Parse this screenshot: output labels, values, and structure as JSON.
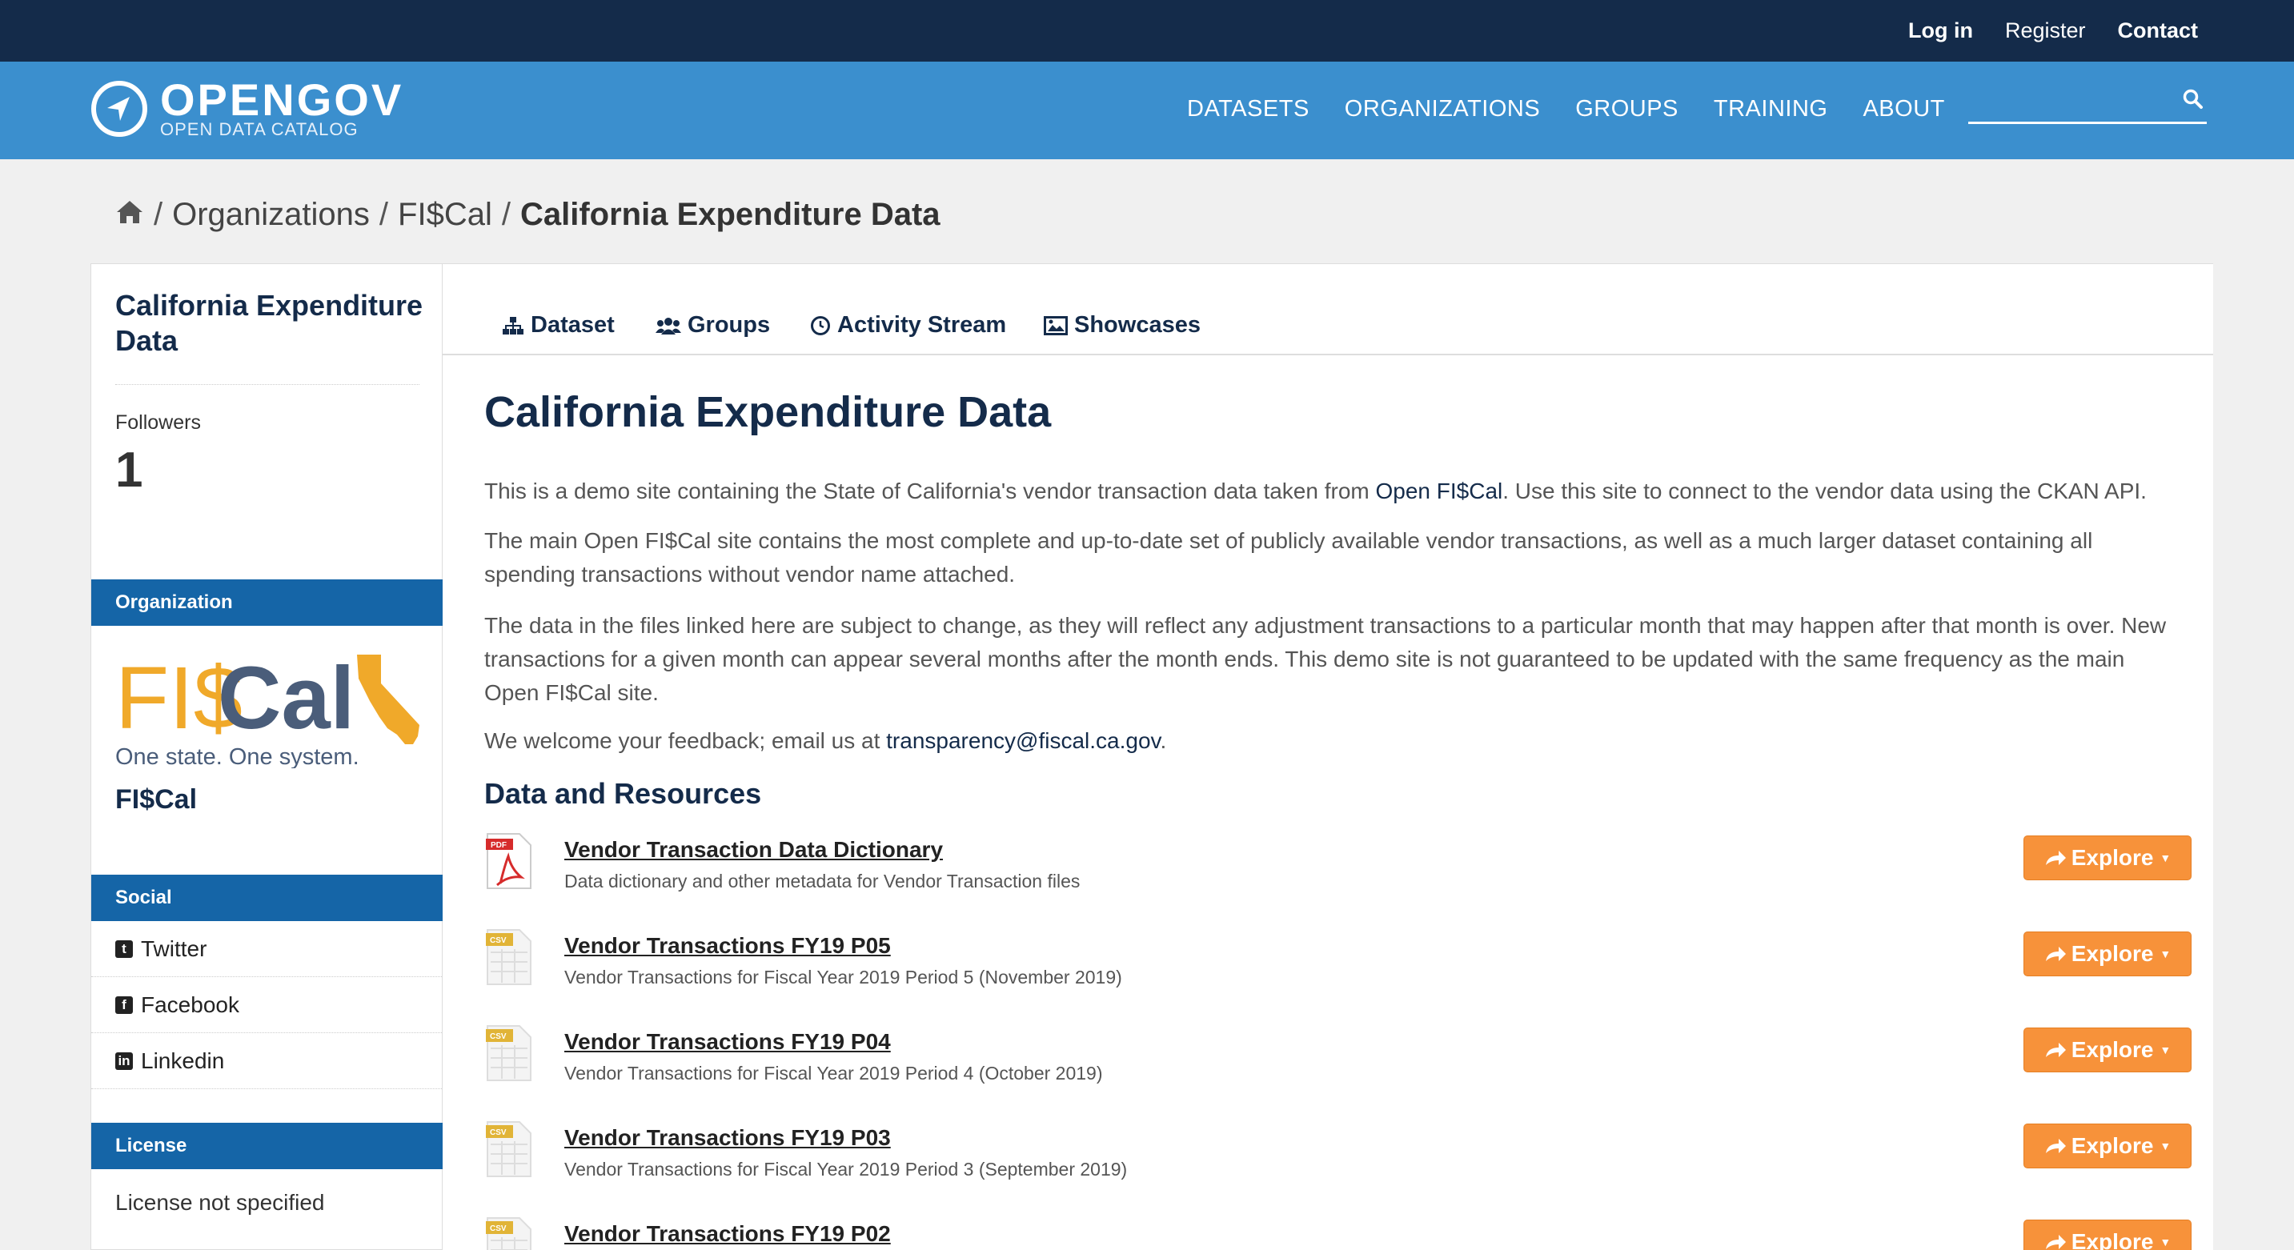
{
  "topbar": {
    "login": "Log in",
    "register": "Register",
    "contact": "Contact"
  },
  "brand": {
    "name": "OPENGOV",
    "subtitle": "OPEN DATA CATALOG"
  },
  "nav": {
    "items": [
      "DATASETS",
      "ORGANIZATIONS",
      "GROUPS",
      "TRAINING",
      "ABOUT"
    ]
  },
  "search": {
    "placeholder": "",
    "value": ""
  },
  "breadcrumb": {
    "items": [
      "Organizations",
      "FI$Cal"
    ],
    "current": "California Expenditure Data"
  },
  "sidebar": {
    "title": "California Expenditure Data",
    "followers_label": "Followers",
    "followers_count": "1",
    "organization_heading": "Organization",
    "org_logo_word_left": "FI$",
    "org_logo_word_right": "Cal",
    "org_tagline": "One state. One system.",
    "org_name": "FI$Cal",
    "social_heading": "Social",
    "social": [
      "Twitter",
      "Facebook",
      "Linkedin"
    ],
    "license_heading": "License",
    "license_text": "License not specified"
  },
  "tabs": [
    "Dataset",
    "Groups",
    "Activity Stream",
    "Showcases"
  ],
  "main": {
    "title": "California Expenditure Data",
    "p1_before": "This is a demo site containing the State of California's vendor transaction data taken from ",
    "p1_link": "Open FI$Cal",
    "p1_after": ". Use this site to connect to the vendor data using the CKAN API.",
    "p2": "The main Open FI$Cal site contains the most complete and up-to-date set of publicly available vendor transactions, as well as a much larger dataset containing all spending transactions without vendor name attached.",
    "p3": "The data in the files linked here are subject to change, as they will reflect any adjustment transactions to a particular month that may happen after that month is over. New transactions for a given month can appear several months after the month ends. This demo site is not guaranteed to be updated with the same frequency as the main Open FI$Cal site.",
    "p4_before": "We welcome your feedback; email us at ",
    "p4_link": "transparency@fiscal.ca.gov",
    "p4_after": ".",
    "resources_heading": "Data and Resources",
    "explore_label": "Explore",
    "resources": [
      {
        "format": "PDF",
        "title": "Vendor Transaction Data Dictionary",
        "desc": "Data dictionary and other metadata for Vendor Transaction files"
      },
      {
        "format": "CSV",
        "title": "Vendor Transactions FY19 P05",
        "desc": "Vendor Transactions for Fiscal Year 2019 Period 5 (November 2019)"
      },
      {
        "format": "CSV",
        "title": "Vendor Transactions FY19 P04",
        "desc": "Vendor Transactions for Fiscal Year 2019 Period 4 (October 2019)"
      },
      {
        "format": "CSV",
        "title": "Vendor Transactions FY19 P03",
        "desc": "Vendor Transactions for Fiscal Year 2019 Period 3 (September 2019)"
      },
      {
        "format": "CSV",
        "title": "Vendor Transactions FY19 P02",
        "desc": ""
      }
    ]
  },
  "colors": {
    "topbar": "#142b4a",
    "nav": "#3b8fce",
    "accent": "#1565a7",
    "explore": "#f7923a",
    "fiscal_gold": "#f0a92a",
    "fiscal_blue": "#4a5d7a"
  }
}
